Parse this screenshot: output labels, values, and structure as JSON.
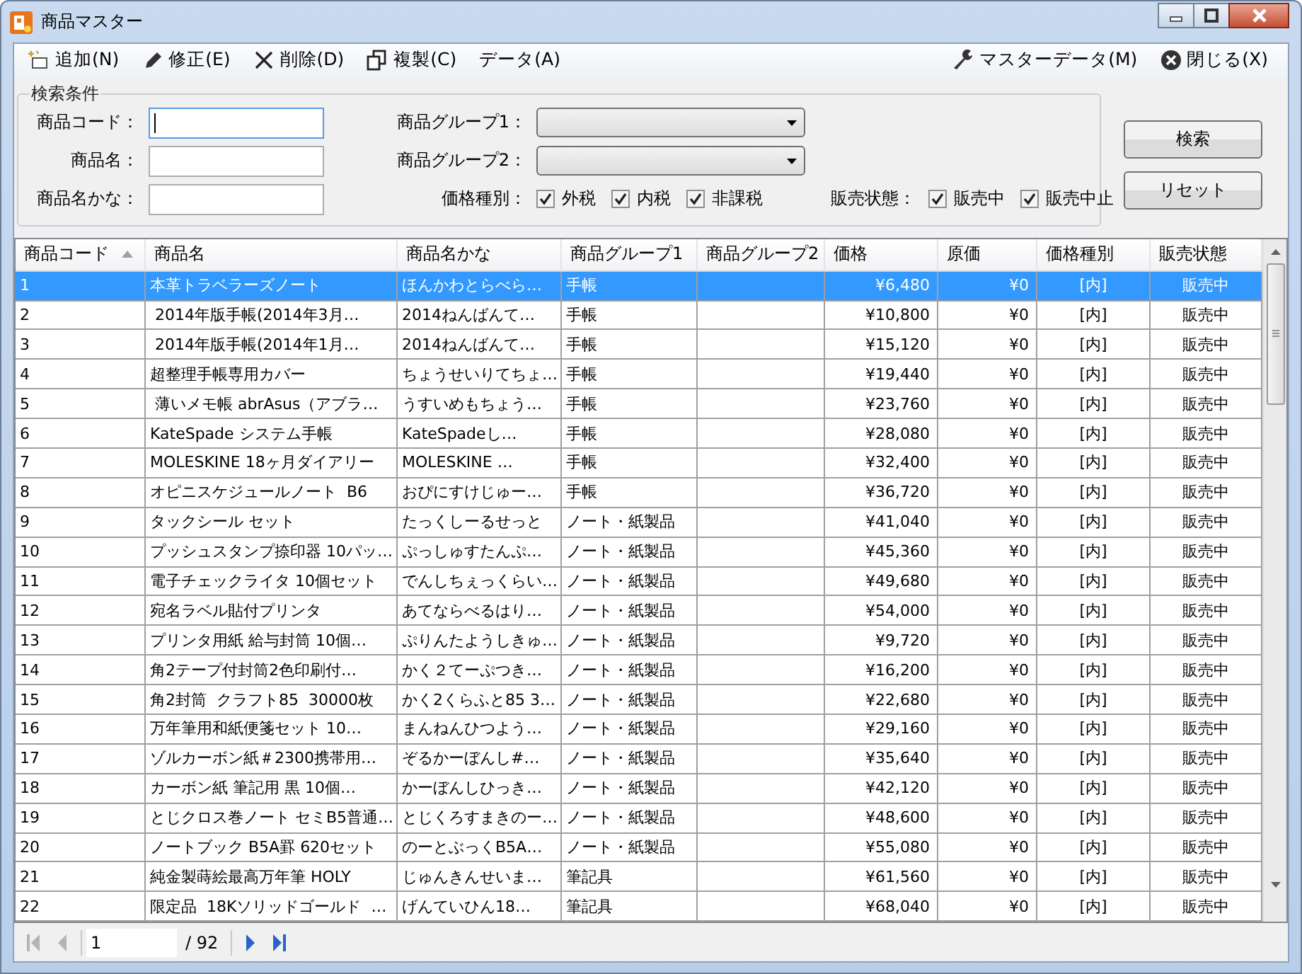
{
  "window": {
    "title": "商品マスター"
  },
  "menu": {
    "left": [
      {
        "label": "追加(N)"
      },
      {
        "label": "修正(E)"
      },
      {
        "label": "削除(D)"
      },
      {
        "label": "複製(C)"
      },
      {
        "label": "データ(A)"
      }
    ],
    "right": [
      {
        "label": "マスターデータ(M)"
      },
      {
        "label": "閉じる(X)"
      }
    ]
  },
  "search": {
    "title": "検索条件",
    "fields": [
      {
        "label": "商品コード：",
        "focused": true
      },
      {
        "label": "商品名：",
        "focused": false
      },
      {
        "label": "商品名かな：",
        "focused": false
      }
    ],
    "dropdowns": [
      {
        "label": "商品グループ1："
      },
      {
        "label": "商品グループ2："
      }
    ],
    "price_type": {
      "label": "価格種別：",
      "options": [
        {
          "label": "外税",
          "checked": true
        },
        {
          "label": "内税",
          "checked": true
        },
        {
          "label": "非課税",
          "checked": true
        }
      ]
    },
    "sales_status": {
      "label": "販売状態：",
      "options": [
        {
          "label": "販売中",
          "checked": true
        },
        {
          "label": "販売中止",
          "checked": true
        }
      ]
    },
    "buttons": [
      "検索",
      "リセット"
    ]
  },
  "table": {
    "columns": [
      {
        "label": "商品コード",
        "sorted": true
      },
      {
        "label": "商品名",
        "sorted": false
      },
      {
        "label": "商品名かな",
        "sorted": false
      },
      {
        "label": "商品グループ1",
        "sorted": false
      },
      {
        "label": "商品グループ2",
        "sorted": false
      },
      {
        "label": "価格",
        "sorted": false
      },
      {
        "label": "原価",
        "sorted": false
      },
      {
        "label": "価格種別",
        "sorted": false
      },
      {
        "label": "販売状態",
        "sorted": false
      }
    ],
    "rows": [
      {
        "selected": true,
        "code": "1",
        "name": "本革トラベラーズノート",
        "kana": "ほんかわとらべら…",
        "group1": "手帳",
        "price": "¥6,480",
        "cost": "¥0",
        "price_type": "[内]",
        "status": "販売中"
      },
      {
        "selected": false,
        "code": "2",
        "name": " 2014年版手帳(2014年3月…",
        "kana": "2014ねんばんて…",
        "group1": "手帳",
        "price": "¥10,800",
        "cost": "¥0",
        "price_type": "[内]",
        "status": "販売中"
      },
      {
        "selected": false,
        "code": "3",
        "name": " 2014年版手帳(2014年1月…",
        "kana": "2014ねんばんて…",
        "group1": "手帳",
        "price": "¥15,120",
        "cost": "¥0",
        "price_type": "[内]",
        "status": "販売中"
      },
      {
        "selected": false,
        "code": "4",
        "name": "超整理手帳専用カバー",
        "kana": "ちょうせいりてちょ…",
        "group1": "手帳",
        "price": "¥19,440",
        "cost": "¥0",
        "price_type": "[内]",
        "status": "販売中"
      },
      {
        "selected": false,
        "code": "5",
        "name": " 薄いメモ帳 abrAsus（アブラ…",
        "kana": "うすいめもちょう…",
        "group1": "手帳",
        "price": "¥23,760",
        "cost": "¥0",
        "price_type": "[内]",
        "status": "販売中"
      },
      {
        "selected": false,
        "code": "6",
        "name": "KateSpade システム手帳",
        "kana": "KateSpadeし…",
        "group1": "手帳",
        "price": "¥28,080",
        "cost": "¥0",
        "price_type": "[内]",
        "status": "販売中"
      },
      {
        "selected": false,
        "code": "7",
        "name": "MOLESKINE 18ヶ月ダイアリー",
        "kana": "MOLESKINE …",
        "group1": "手帳",
        "price": "¥32,400",
        "cost": "¥0",
        "price_type": "[内]",
        "status": "販売中"
      },
      {
        "selected": false,
        "code": "8",
        "name": "オピニスケジュールノート  B6",
        "kana": "おぴにすけじゅー…",
        "group1": "手帳",
        "price": "¥36,720",
        "cost": "¥0",
        "price_type": "[内]",
        "status": "販売中"
      },
      {
        "selected": false,
        "code": "9",
        "name": "タックシール セット",
        "kana": "たっくしーるせっと",
        "group1": "ノート・紙製品",
        "price": "¥41,040",
        "cost": "¥0",
        "price_type": "[内]",
        "status": "販売中"
      },
      {
        "selected": false,
        "code": "10",
        "name": "プッシュスタンプ捺印器 10パッ…",
        "kana": "ぷっしゅすたんぷ…",
        "group1": "ノート・紙製品",
        "price": "¥45,360",
        "cost": "¥0",
        "price_type": "[内]",
        "status": "販売中"
      },
      {
        "selected": false,
        "code": "11",
        "name": "電子チェックライタ 10個セット",
        "kana": "でんしちぇっくらい…",
        "group1": "ノート・紙製品",
        "price": "¥49,680",
        "cost": "¥0",
        "price_type": "[内]",
        "status": "販売中"
      },
      {
        "selected": false,
        "code": "12",
        "name": "宛名ラベル貼付プリンタ",
        "kana": "あてならべるはり…",
        "group1": "ノート・紙製品",
        "price": "¥54,000",
        "cost": "¥0",
        "price_type": "[内]",
        "status": "販売中"
      },
      {
        "selected": false,
        "code": "13",
        "name": "プリンタ用紙 給与封筒 10個…",
        "kana": "ぷりんたようしきゅ…",
        "group1": "ノート・紙製品",
        "price": "¥9,720",
        "cost": "¥0",
        "price_type": "[内]",
        "status": "販売中"
      },
      {
        "selected": false,
        "code": "14",
        "name": "角2テープ付封筒2色印刷付…",
        "kana": "かく２てーぷつき…",
        "group1": "ノート・紙製品",
        "price": "¥16,200",
        "cost": "¥0",
        "price_type": "[内]",
        "status": "販売中"
      },
      {
        "selected": false,
        "code": "15",
        "name": "角2封筒  クラフト85  30000枚",
        "kana": "かく2くらふと85 3…",
        "group1": "ノート・紙製品",
        "price": "¥22,680",
        "cost": "¥0",
        "price_type": "[内]",
        "status": "販売中"
      },
      {
        "selected": false,
        "code": "16",
        "name": "万年筆用和紙便箋セット 10…",
        "kana": "まんねんひつよう…",
        "group1": "ノート・紙製品",
        "price": "¥29,160",
        "cost": "¥0",
        "price_type": "[内]",
        "status": "販売中"
      },
      {
        "selected": false,
        "code": "17",
        "name": "ゾルカーボン紙＃2300携帯用…",
        "kana": "ぞるかーぼんし#…",
        "group1": "ノート・紙製品",
        "price": "¥35,640",
        "cost": "¥0",
        "price_type": "[内]",
        "status": "販売中"
      },
      {
        "selected": false,
        "code": "18",
        "name": "カーボン紙 筆記用 黒 10個…",
        "kana": "かーぼんしひっき…",
        "group1": "ノート・紙製品",
        "price": "¥42,120",
        "cost": "¥0",
        "price_type": "[内]",
        "status": "販売中"
      },
      {
        "selected": false,
        "code": "19",
        "name": "とじクロス巻ノート セミB5普通…",
        "kana": "とじくろすまきのー…",
        "group1": "ノート・紙製品",
        "price": "¥48,600",
        "cost": "¥0",
        "price_type": "[内]",
        "status": "販売中"
      },
      {
        "selected": false,
        "code": "20",
        "name": "ノートブック B5A罫 620セット",
        "kana": "のーとぶっくB5A…",
        "group1": "ノート・紙製品",
        "price": "¥55,080",
        "cost": "¥0",
        "price_type": "[内]",
        "status": "販売中"
      },
      {
        "selected": false,
        "code": "21",
        "name": "純金製蒔絵最高万年筆 HOLY",
        "kana": "じゅんきんせいま…",
        "group1": "筆記具",
        "price": "¥61,560",
        "cost": "¥0",
        "price_type": "[内]",
        "status": "販売中"
      },
      {
        "selected": false,
        "code": "22",
        "name": "限定品  18Kソリッドゴールド  …",
        "kana": "げんていひん18…",
        "group1": "筆記具",
        "price": "¥68,040",
        "cost": "¥0",
        "price_type": "[内]",
        "status": "販売中"
      }
    ]
  },
  "pager": {
    "page": "1",
    "total": "/ 92",
    "nav": [
      {
        "kind": "first",
        "disabled": true
      },
      {
        "kind": "prev",
        "disabled": true
      },
      {
        "kind": "next",
        "disabled": false
      },
      {
        "kind": "last",
        "disabled": false
      }
    ]
  }
}
